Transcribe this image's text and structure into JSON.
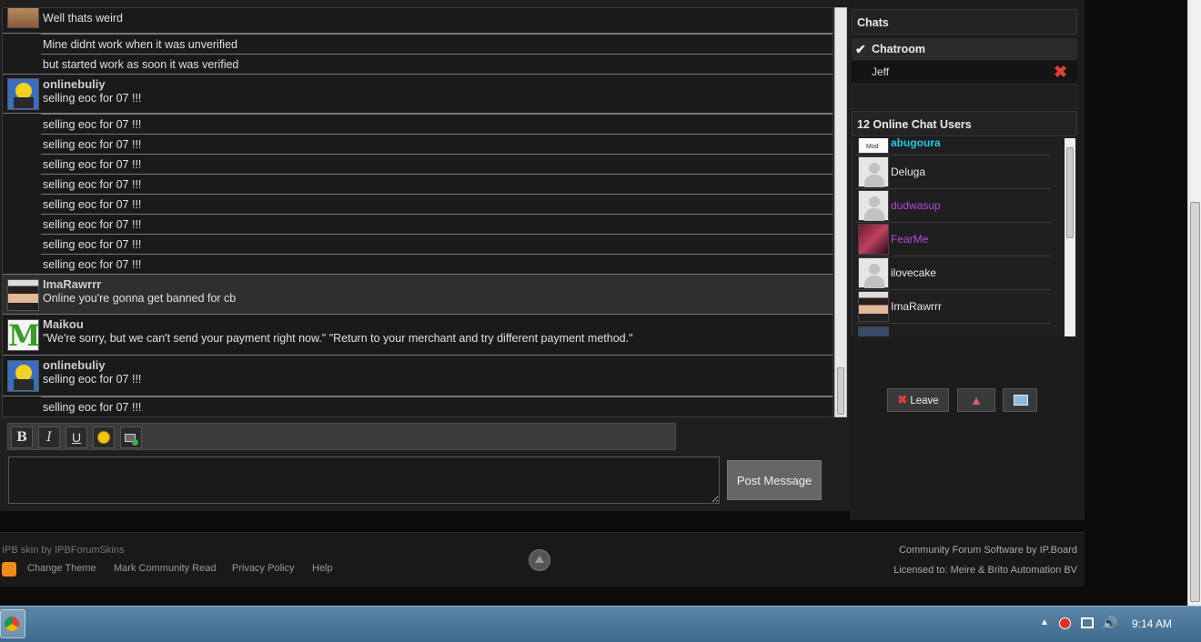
{
  "chat": {
    "messages": [
      {
        "user": "",
        "text": "Well thats weird"
      },
      {
        "text": "Mine didnt work when it was unverified"
      },
      {
        "text": "but started work as soon it was verified"
      },
      {
        "user": "onlinebuliy",
        "text": "selling eoc for 07 !!!"
      },
      {
        "text": "selling eoc for 07 !!!"
      },
      {
        "text": "selling eoc for 07 !!!"
      },
      {
        "text": "selling eoc for 07 !!!"
      },
      {
        "text": "selling eoc for 07 !!!"
      },
      {
        "text": "selling eoc for 07 !!!"
      },
      {
        "text": "selling eoc for 07 !!!"
      },
      {
        "text": "selling eoc for 07 !!!"
      },
      {
        "text": "selling eoc for 07 !!!"
      },
      {
        "user": "ImaRawrrr",
        "text": "Online you're gonna get banned for cb"
      },
      {
        "user": "Maikou",
        "text": "\"We're sorry, but we can't send your payment right now.\" \"Return to your merchant and try different payment method.\""
      },
      {
        "user": "onlinebuliy",
        "text": "selling eoc for 07 !!!"
      },
      {
        "text": "selling eoc for 07 !!!"
      }
    ],
    "toolbar": {
      "bold": "B",
      "italic": "I",
      "underline": "U"
    },
    "composer_placeholder": "",
    "post_button": "Post Message",
    "maikou_avatar_letter": "M"
  },
  "sidebar": {
    "chats_title": "Chats",
    "chatroom_label": "Chatroom",
    "jeff_label": "Jeff",
    "online_title": "12 Online Chat Users",
    "users": [
      {
        "name": "abugoura",
        "color": "#1ec9e8",
        "badge": "Mod"
      },
      {
        "name": "Deluga",
        "color": "#e8e8e8"
      },
      {
        "name": "dudwasup",
        "color": "#b04be0"
      },
      {
        "name": "FearMe",
        "color": "#b04be0"
      },
      {
        "name": "ilovecake",
        "color": "#e8e8e8"
      },
      {
        "name": "ImaRawrrr",
        "color": "#e8e8e8"
      }
    ],
    "leave_button": "Leave"
  },
  "footer": {
    "skin_credit": "IPB skin by IPBForumSkins",
    "links": [
      "Change Theme",
      "Mark Community Read",
      "Privacy Policy",
      "Help"
    ],
    "software": "Community Forum Software by IP.Board",
    "license": "Licensed to: Meire & Brito Automation BV"
  },
  "taskbar": {
    "clock": "9:14 AM"
  },
  "colors": {
    "accent_red": "#e0403a",
    "mod_cyan": "#1ec9e8",
    "member_purple": "#b04be0"
  }
}
